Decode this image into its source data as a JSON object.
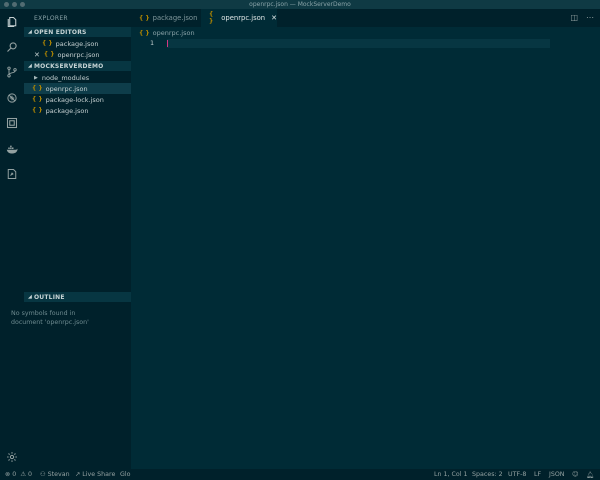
{
  "window": {
    "title": "openrpc.json — MockServerDemo"
  },
  "activity_bar": {
    "icons": [
      "files-icon",
      "search-icon",
      "source-control-icon",
      "debug-icon",
      "extensions-icon",
      "docker-icon",
      "live-share-icon",
      "settings-gear-icon"
    ]
  },
  "sidebar": {
    "title": "EXPLORER",
    "open_editors": {
      "header": "OPEN EDITORS",
      "items": [
        {
          "icon": "{ }",
          "label": "package.json"
        },
        {
          "close": "✕",
          "icon": "{ }",
          "label": "openrpc.json"
        }
      ]
    },
    "workspace": {
      "header": "MOCKSERVERDEMO",
      "items": [
        {
          "label": "node_modules"
        },
        {
          "icon": "{ }",
          "label": "openrpc.json"
        },
        {
          "icon": "{ }",
          "label": "package-lock.json"
        },
        {
          "icon": "{ }",
          "label": "package.json"
        }
      ]
    },
    "outline": {
      "header": "OUTLINE",
      "message": "No symbols found in document 'openrpc.json'"
    }
  },
  "editor": {
    "tabs": [
      {
        "icon": "{ }",
        "label": "package.json"
      },
      {
        "icon": "{ }",
        "label": "openrpc.json",
        "close": "✕"
      }
    ],
    "breadcrumb": {
      "icon": "{ }",
      "label": "openrpc.json"
    },
    "line_number": "1"
  },
  "statusbar": {
    "errors": "0",
    "warnings": "0",
    "user": "Stevan",
    "live_share": "Live Share",
    "extra": "Glo",
    "position": "Ln 1, Col 1",
    "spaces": "Spaces: 2",
    "encoding": "UTF-8",
    "eol": "LF",
    "language": "JSON"
  },
  "colors": {
    "background": "#002b36",
    "sidebar": "#00212b",
    "accent_braces": "#b58900",
    "cursor": "#d33682"
  }
}
